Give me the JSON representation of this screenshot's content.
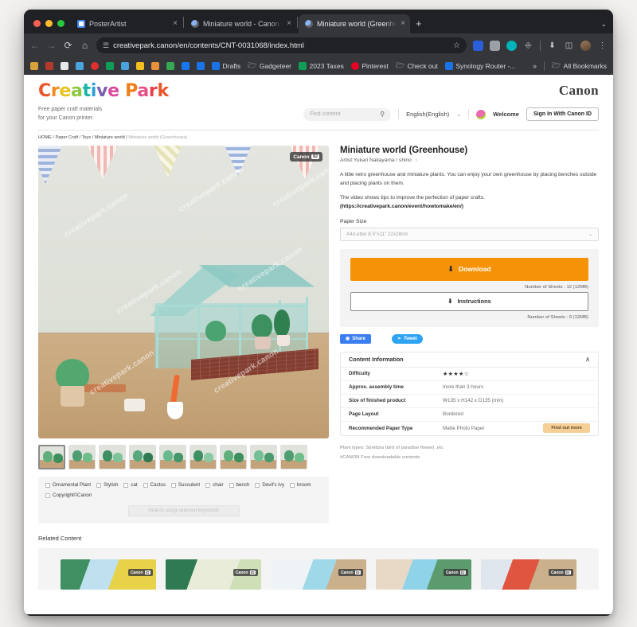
{
  "browser": {
    "tabs": [
      {
        "title": "PosterArtist",
        "active": false,
        "favicon": "posterartist-icon"
      },
      {
        "title": "Miniature world - Canon Cre",
        "active": false,
        "favicon": "globe-icon"
      },
      {
        "title": "Miniature world (Greenhouse",
        "active": true,
        "favicon": "globe-icon"
      }
    ],
    "new_tab_label": "+",
    "tab_close_label": "×",
    "tabstrip_menu": "⌄",
    "nav": {
      "back": "←",
      "forward": "→",
      "reload": "⟳",
      "home": "⌂"
    },
    "omnibox": {
      "url": "creativepark.canon/en/contents/CNT-0031068/index.html",
      "lead_icon": "site-settings-icon",
      "star": "☆"
    },
    "toolbar_icons": [
      "shield-extension-icon",
      "screenshot-extension-icon",
      "color-extension-icon",
      "puzzle-extension-icon",
      "downloads-icon",
      "side-panel-icon",
      "profile-avatar-icon",
      "menu-icon"
    ],
    "bookmarks": [
      {
        "label": "",
        "icon": "analytics-bookmark-icon",
        "color": "#d8a13a"
      },
      {
        "label": "",
        "icon": "wu-bookmark-icon",
        "color": "#b33a2a"
      },
      {
        "label": "",
        "icon": "dark-bookmark-icon",
        "color": "#e8e8e8"
      },
      {
        "label": "",
        "icon": "robot-bookmark-icon",
        "color": "#4aa3df"
      },
      {
        "label": "",
        "icon": "youtube-bookmark-icon",
        "color": "#e02f2f"
      },
      {
        "label": "",
        "icon": "gdrive-green-icon",
        "color": "#0f9d58"
      },
      {
        "label": "",
        "icon": "gdrive-icon",
        "color": "#4aa3df"
      },
      {
        "label": "",
        "icon": "notes-bookmark-icon",
        "color": "#f4c020"
      },
      {
        "label": "",
        "icon": "chart-bookmark-icon",
        "color": "#e8913a"
      },
      {
        "label": "",
        "icon": "photos-bookmark-icon",
        "color": "#34a853"
      },
      {
        "label": "",
        "icon": "facebook-bookmark-icon",
        "color": "#1877f2"
      },
      {
        "label": "",
        "icon": "blue-app-icon",
        "color": "#1a73e8"
      },
      {
        "label": "Drafts",
        "icon": "drafts-icon",
        "color": "#1a73e8"
      },
      {
        "label": "Gadgeteer",
        "icon": "folder-icon",
        "color": ""
      },
      {
        "label": "2023 Taxes",
        "icon": "sheets-icon",
        "color": "#0f9d58"
      },
      {
        "label": "Pinterest",
        "icon": "pinterest-icon",
        "color": "#e60023"
      },
      {
        "label": "Check out",
        "icon": "folder-icon",
        "color": ""
      },
      {
        "label": "Synology Router -...",
        "icon": "synology-icon",
        "color": "#1a73e8"
      }
    ],
    "bookmarks_overflow": "»",
    "all_bookmarks_label": "All Bookmarks",
    "all_bookmarks_icon": "folder-icon"
  },
  "site": {
    "logo_text": "Creative Park",
    "logo_letters": [
      {
        "c": "C",
        "color": "#e8562a"
      },
      {
        "c": "r",
        "color": "#ef8b1c"
      },
      {
        "c": "e",
        "color": "#e8c21e"
      },
      {
        "c": "a",
        "color": "#8dc63f"
      },
      {
        "c": "t",
        "color": "#18b4a8"
      },
      {
        "c": "i",
        "color": "#2a9fd6"
      },
      {
        "c": "v",
        "color": "#7a5fb0"
      },
      {
        "c": "e",
        "color": "#d94a9e"
      },
      {
        "c": " ",
        "color": "#000000"
      },
      {
        "c": "P",
        "color": "#ef7d1a"
      },
      {
        "c": "a",
        "color": "#e84f8a"
      },
      {
        "c": "r",
        "color": "#e8404a"
      },
      {
        "c": "k",
        "color": "#e8562a"
      }
    ],
    "brand": "Canon",
    "tagline_line1": "Free paper craft materials",
    "tagline_line2": "for your Canon printer.",
    "search_placeholder": "Find content",
    "search_icon": "search-icon",
    "language": "English(English)",
    "language_chevron": "⌄",
    "welcome": "Welcome",
    "avatar_icon": "user-avatar-icon",
    "signin_label": "Sign In With Canon ID",
    "breadcrumb": [
      {
        "label": "HOME",
        "current": false
      },
      {
        "label": "Paper Craft",
        "current": false
      },
      {
        "label": "Toys",
        "current": false
      },
      {
        "label": "Miniature world",
        "current": false
      },
      {
        "label": "Miniature world (Greenhouse)",
        "current": true
      }
    ],
    "breadcrumb_sep": "/"
  },
  "gallery": {
    "canon_id_badge": {
      "text": "Canon",
      "mark": "ID"
    },
    "watermark_text": "creativepark.canon",
    "thumbnails": [
      {
        "selected": true
      },
      {
        "selected": false
      },
      {
        "selected": false
      },
      {
        "selected": false
      },
      {
        "selected": false
      },
      {
        "selected": false
      },
      {
        "selected": false
      },
      {
        "selected": false
      },
      {
        "selected": false
      }
    ]
  },
  "keywords": {
    "items": [
      "Ornamental Plant",
      "Stylish",
      "cat",
      "Cactus",
      "Succulent",
      "chair",
      "bench",
      "Devil's Ivy",
      "broom",
      "Copyright©Canon"
    ],
    "search_button": "Search using selected keywords"
  },
  "detail": {
    "title": "Miniature world (Greenhouse)",
    "artist": "Artist:Yukari Nakayama / shino",
    "artist_arrow": "›",
    "description": "A little retro greenhouse and miniature plants. You can enjoy your own greenhouse by placing benches outside and placing plants on them.",
    "video_note": "The video shows tips to improve the perfection of paper crafts.",
    "video_url": "(https://creativepark.canon/event/howtomake/en/)",
    "paper_size_label": "Paper Size",
    "paper_size_value": "A4/Letter 8.5\"x11\" 22x28cm",
    "select_chevron": "⌄",
    "download_label": "Download",
    "download_icon": "download-icon",
    "download_sheets": "Number of Sheets : 12 (12MB)",
    "instructions_label": "Instructions",
    "instructions_icon": "download-icon",
    "instructions_sheets": "Number of Sheets : 9 (12MB)",
    "share_label": "Share",
    "share_icon": "facebook-icon",
    "tweet_label": "Tweet",
    "tweet_icon": "twitter-icon",
    "accent_orange": "#f59207"
  },
  "content_information": {
    "heading": "Content Information",
    "collapse_icon": "∧",
    "rows": [
      {
        "key": "Difficulty",
        "value": "★★★★☆",
        "is_stars": true
      },
      {
        "key": "Approx. assembly time",
        "value": "more than 3 hours",
        "is_stars": false
      },
      {
        "key": "Size of finished product",
        "value": "W135 x H142 x D135 (mm)",
        "is_stars": false
      },
      {
        "key": "Page Layout",
        "value": "Bordered",
        "is_stars": false
      },
      {
        "key": "Recommended Paper Type",
        "value": "Matte Photo Paper",
        "is_stars": false,
        "button": "Find out more"
      }
    ]
  },
  "notes": {
    "plant_types": "Plant types: Strelitzia (bird of paradise flower) ,etc",
    "hashtag": "#CANON Free downloadable contents"
  },
  "related": {
    "title": "Related Content",
    "canon_id_badge": {
      "text": "Canon",
      "mark": "ID"
    },
    "items": [
      {
        "name": "related-item-1"
      },
      {
        "name": "related-item-2"
      },
      {
        "name": "related-item-3"
      },
      {
        "name": "related-item-4"
      },
      {
        "name": "related-item-5"
      }
    ]
  }
}
